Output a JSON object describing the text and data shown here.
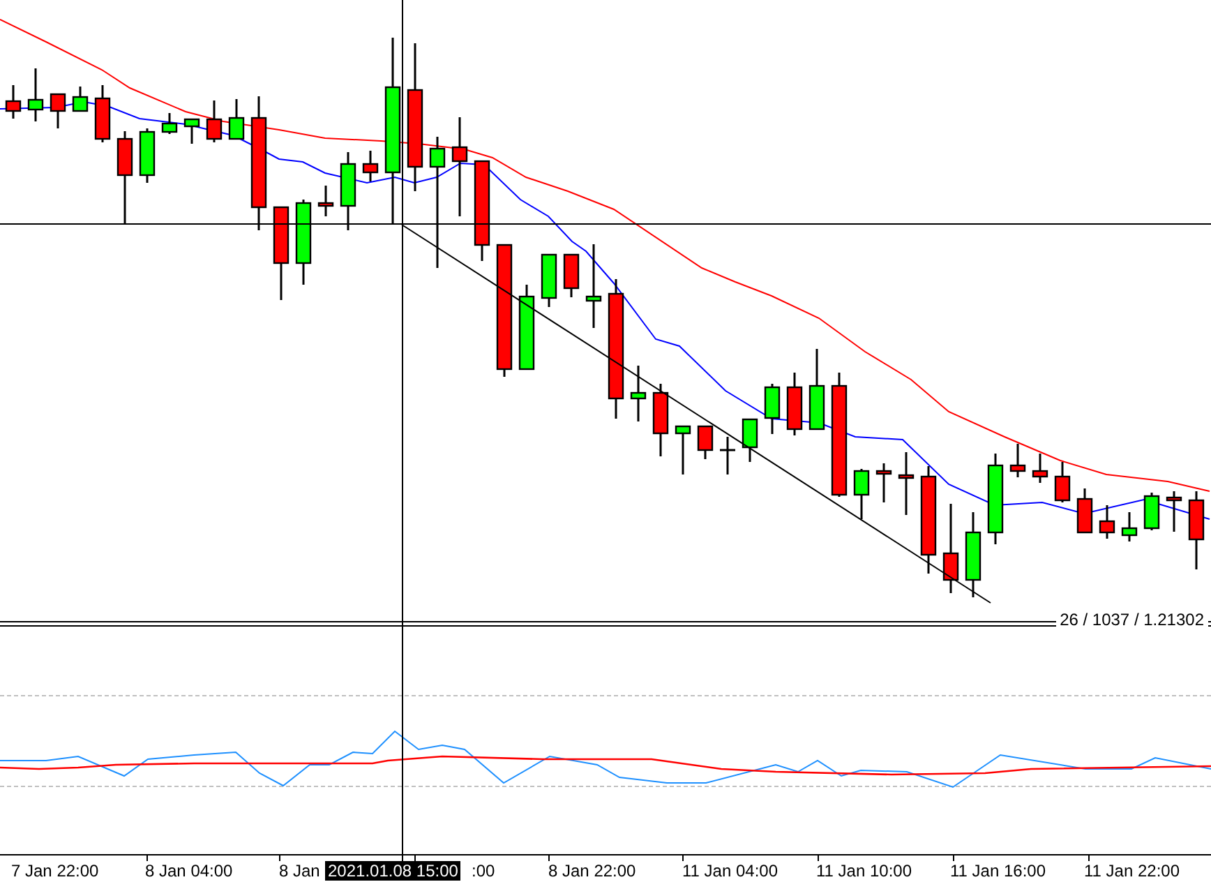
{
  "time_axis": {
    "labels": [
      {
        "text": "7 Jan 22:00"
      },
      {
        "text": "8 Jan 04:00"
      },
      {
        "text": "8 Jan"
      },
      {
        "text": ":00"
      },
      {
        "text": "8 Jan 22:00"
      },
      {
        "text": "11 Jan 04:00"
      },
      {
        "text": "11 Jan 10:00"
      },
      {
        "text": "11 Jan 16:00"
      },
      {
        "text": "11 Jan 22:00"
      }
    ]
  },
  "crosshair": {
    "time_label": "2021.01.08 15:00",
    "readout": "26 / 1037 / 1.21302"
  }
}
